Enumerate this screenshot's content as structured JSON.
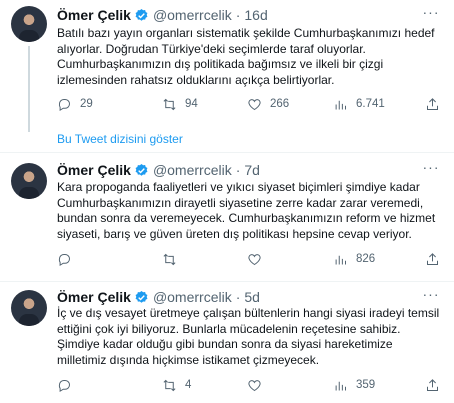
{
  "tweets": [
    {
      "name": "Ömer Çelik",
      "handle": "@omerrcelik",
      "time": "16d",
      "text": "Batılı bazı yayın organları sistematik şekilde Cumhurbaşkanımızı hedef alıyorlar. Doğrudan Türkiye'deki seçimlerde taraf oluyorlar. Cumhurbaşkanımızın dış politikada bağımsız ve ilkeli bir çizgi izlemesinden rahatsız olduklarını açıkça belirtiyorlar.",
      "replies": "29",
      "retweets": "94",
      "likes": "266",
      "views": "6.741"
    },
    {
      "name": "Ömer Çelik",
      "handle": "@omerrcelik",
      "time": "7d",
      "text": "Kara propoganda faaliyetleri ve yıkıcı siyaset biçimleri şimdiye kadar Cumhurbaşkanımızın dirayetli siyasetine zerre kadar zarar veremedi, bundan sonra da veremeyecek. Cumhurbaşkanımızın reform ve hizmet siyaseti, barış ve güven üreten dış politikası hepsine cevap veriyor.",
      "replies": "",
      "retweets": "",
      "likes": "",
      "views": "826"
    },
    {
      "name": "Ömer Çelik",
      "handle": "@omerrcelik",
      "time": "5d",
      "text": "İç ve dış vesayet üretmeye çalışan bültenlerin hangi siyasi iradeyi temsil ettiğini çok iyi biliyoruz. Bunlarla mücadelenin reçetesine sahibiz. Şimdiye kadar olduğu gibi bundan sonra da siyasi hareketimize milletimiz dışında hiçkimse istikamet çizmeyecek.",
      "replies": "",
      "retweets": "4",
      "likes": "",
      "views": "359"
    }
  ],
  "show_thread_label": "Bu Tweet dizisini göster",
  "colors": {
    "accent": "#1d9bf0",
    "muted": "#536471",
    "text": "#0f1419",
    "divider": "#eff3f4"
  },
  "icons": [
    "verified-badge-icon",
    "more-icon",
    "reply-icon",
    "retweet-icon",
    "like-icon",
    "views-icon"
  ]
}
